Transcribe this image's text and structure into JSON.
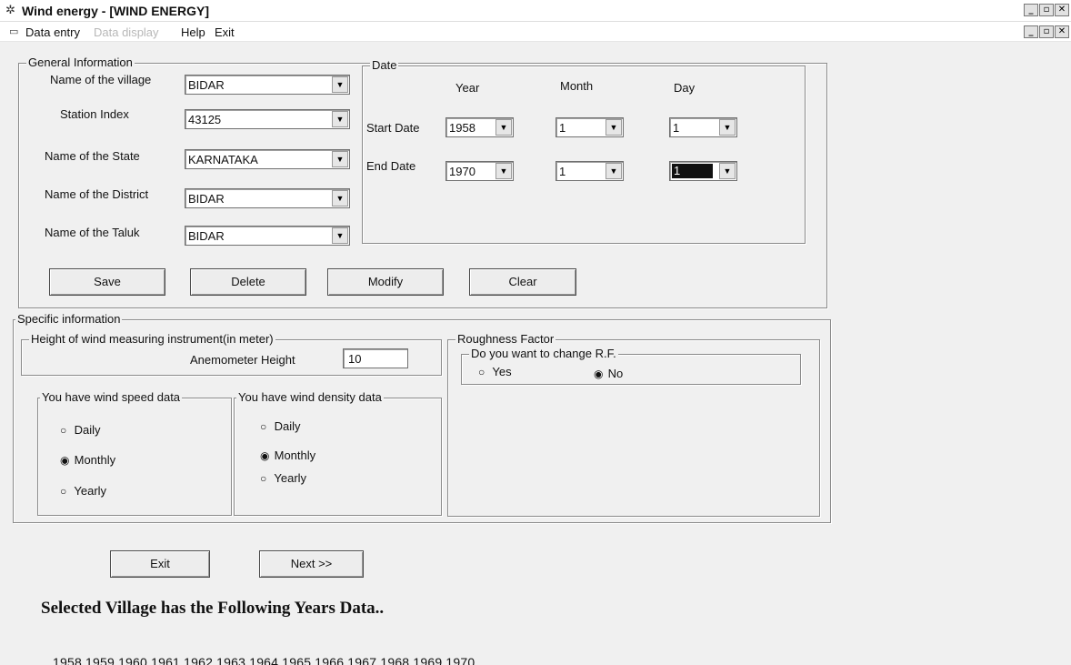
{
  "window": {
    "icon": "app-icon",
    "title": "Wind energy - [WIND ENERGY]"
  },
  "menu": {
    "items": [
      {
        "label": "Data entry",
        "enabled": true
      },
      {
        "label": "Data display",
        "enabled": false
      },
      {
        "label": "Help",
        "enabled": true
      },
      {
        "label": "Exit",
        "enabled": true
      }
    ]
  },
  "general": {
    "legend": "General Information",
    "village_label": "Name of the village",
    "village": "BIDAR",
    "station_label": "Station Index",
    "station": "43125",
    "state_label": "Name of the State",
    "state": "KARNATAKA",
    "district_label": "Name of the District",
    "district": "BIDAR",
    "taluk_label": "Name of the Taluk",
    "taluk": "BIDAR",
    "date": {
      "legend": "Date",
      "year_header": "Year",
      "month_header": "Month",
      "day_header": "Day",
      "start_label": "Start Date",
      "start_year": "1958",
      "start_month": "1",
      "start_day": "1",
      "end_label": "End Date",
      "end_year": "1970",
      "end_month": "1",
      "end_day": "1"
    },
    "buttons": {
      "save": "Save",
      "delete": "Delete",
      "modify": "Modify",
      "clear": "Clear"
    }
  },
  "specific": {
    "legend": "Specific information",
    "height_legend": "Height of wind measuring instrument(in meter)",
    "anemometer_label": "Anemometer Height",
    "anemometer_value": "10",
    "roughness_legend": "Roughness Factor",
    "change_rf_legend": "Do you want to change R.F.",
    "rf_yes": "Yes",
    "rf_no": "No",
    "rf_selected": "No",
    "speed_legend": "You have wind speed data",
    "density_legend": "You have wind density data",
    "opt_daily": "Daily",
    "opt_monthly": "Monthly",
    "opt_yearly": "Yearly",
    "speed_selected": "Monthly",
    "density_selected": "Monthly"
  },
  "bottom": {
    "exit": "Exit",
    "next": "Next >>",
    "message": "Selected Village has the Following Years Data..",
    "years": "1958 1959 1960 1961 1962 1963 1964 1965 1966 1967 1968 1969 1970"
  }
}
